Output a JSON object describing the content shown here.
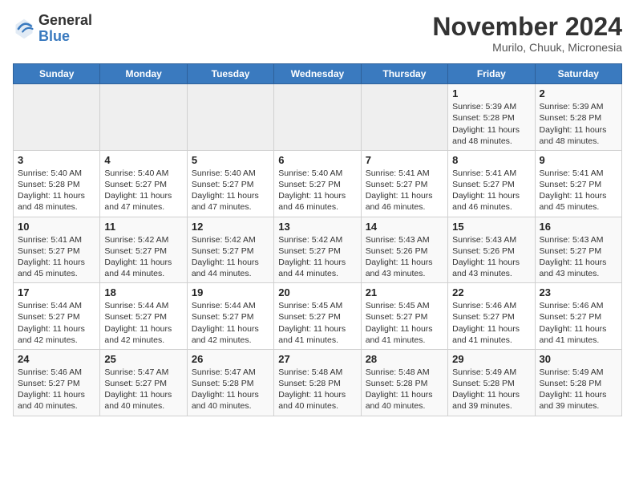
{
  "header": {
    "logo_general": "General",
    "logo_blue": "Blue",
    "month_title": "November 2024",
    "location": "Murilo, Chuuk, Micronesia"
  },
  "weekdays": [
    "Sunday",
    "Monday",
    "Tuesday",
    "Wednesday",
    "Thursday",
    "Friday",
    "Saturday"
  ],
  "weeks": [
    [
      {
        "day": "",
        "info": ""
      },
      {
        "day": "",
        "info": ""
      },
      {
        "day": "",
        "info": ""
      },
      {
        "day": "",
        "info": ""
      },
      {
        "day": "",
        "info": ""
      },
      {
        "day": "1",
        "info": "Sunrise: 5:39 AM\nSunset: 5:28 PM\nDaylight: 11 hours and 48 minutes."
      },
      {
        "day": "2",
        "info": "Sunrise: 5:39 AM\nSunset: 5:28 PM\nDaylight: 11 hours and 48 minutes."
      }
    ],
    [
      {
        "day": "3",
        "info": "Sunrise: 5:40 AM\nSunset: 5:28 PM\nDaylight: 11 hours and 48 minutes."
      },
      {
        "day": "4",
        "info": "Sunrise: 5:40 AM\nSunset: 5:27 PM\nDaylight: 11 hours and 47 minutes."
      },
      {
        "day": "5",
        "info": "Sunrise: 5:40 AM\nSunset: 5:27 PM\nDaylight: 11 hours and 47 minutes."
      },
      {
        "day": "6",
        "info": "Sunrise: 5:40 AM\nSunset: 5:27 PM\nDaylight: 11 hours and 46 minutes."
      },
      {
        "day": "7",
        "info": "Sunrise: 5:41 AM\nSunset: 5:27 PM\nDaylight: 11 hours and 46 minutes."
      },
      {
        "day": "8",
        "info": "Sunrise: 5:41 AM\nSunset: 5:27 PM\nDaylight: 11 hours and 46 minutes."
      },
      {
        "day": "9",
        "info": "Sunrise: 5:41 AM\nSunset: 5:27 PM\nDaylight: 11 hours and 45 minutes."
      }
    ],
    [
      {
        "day": "10",
        "info": "Sunrise: 5:41 AM\nSunset: 5:27 PM\nDaylight: 11 hours and 45 minutes."
      },
      {
        "day": "11",
        "info": "Sunrise: 5:42 AM\nSunset: 5:27 PM\nDaylight: 11 hours and 44 minutes."
      },
      {
        "day": "12",
        "info": "Sunrise: 5:42 AM\nSunset: 5:27 PM\nDaylight: 11 hours and 44 minutes."
      },
      {
        "day": "13",
        "info": "Sunrise: 5:42 AM\nSunset: 5:27 PM\nDaylight: 11 hours and 44 minutes."
      },
      {
        "day": "14",
        "info": "Sunrise: 5:43 AM\nSunset: 5:26 PM\nDaylight: 11 hours and 43 minutes."
      },
      {
        "day": "15",
        "info": "Sunrise: 5:43 AM\nSunset: 5:26 PM\nDaylight: 11 hours and 43 minutes."
      },
      {
        "day": "16",
        "info": "Sunrise: 5:43 AM\nSunset: 5:27 PM\nDaylight: 11 hours and 43 minutes."
      }
    ],
    [
      {
        "day": "17",
        "info": "Sunrise: 5:44 AM\nSunset: 5:27 PM\nDaylight: 11 hours and 42 minutes."
      },
      {
        "day": "18",
        "info": "Sunrise: 5:44 AM\nSunset: 5:27 PM\nDaylight: 11 hours and 42 minutes."
      },
      {
        "day": "19",
        "info": "Sunrise: 5:44 AM\nSunset: 5:27 PM\nDaylight: 11 hours and 42 minutes."
      },
      {
        "day": "20",
        "info": "Sunrise: 5:45 AM\nSunset: 5:27 PM\nDaylight: 11 hours and 41 minutes."
      },
      {
        "day": "21",
        "info": "Sunrise: 5:45 AM\nSunset: 5:27 PM\nDaylight: 11 hours and 41 minutes."
      },
      {
        "day": "22",
        "info": "Sunrise: 5:46 AM\nSunset: 5:27 PM\nDaylight: 11 hours and 41 minutes."
      },
      {
        "day": "23",
        "info": "Sunrise: 5:46 AM\nSunset: 5:27 PM\nDaylight: 11 hours and 41 minutes."
      }
    ],
    [
      {
        "day": "24",
        "info": "Sunrise: 5:46 AM\nSunset: 5:27 PM\nDaylight: 11 hours and 40 minutes."
      },
      {
        "day": "25",
        "info": "Sunrise: 5:47 AM\nSunset: 5:27 PM\nDaylight: 11 hours and 40 minutes."
      },
      {
        "day": "26",
        "info": "Sunrise: 5:47 AM\nSunset: 5:28 PM\nDaylight: 11 hours and 40 minutes."
      },
      {
        "day": "27",
        "info": "Sunrise: 5:48 AM\nSunset: 5:28 PM\nDaylight: 11 hours and 40 minutes."
      },
      {
        "day": "28",
        "info": "Sunrise: 5:48 AM\nSunset: 5:28 PM\nDaylight: 11 hours and 40 minutes."
      },
      {
        "day": "29",
        "info": "Sunrise: 5:49 AM\nSunset: 5:28 PM\nDaylight: 11 hours and 39 minutes."
      },
      {
        "day": "30",
        "info": "Sunrise: 5:49 AM\nSunset: 5:28 PM\nDaylight: 11 hours and 39 minutes."
      }
    ]
  ]
}
